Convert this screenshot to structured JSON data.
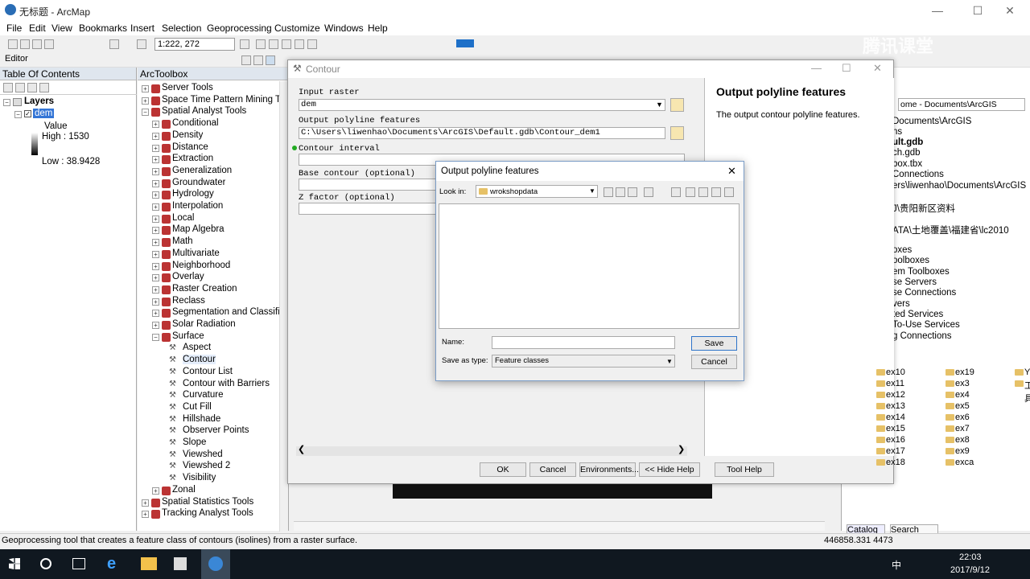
{
  "window": {
    "title": "无标题 - ArcMap"
  },
  "menu": [
    "File",
    "Edit",
    "View",
    "Bookmarks",
    "Insert",
    "Selection",
    "Geoprocessing",
    "Customize",
    "Windows",
    "Help"
  ],
  "toolbar": {
    "scale": "1:222, 272",
    "editor_label": "Editor"
  },
  "toc": {
    "title": "Table Of Contents",
    "layers_label": "Layers",
    "layer_name": "dem",
    "legend_value": "Value",
    "high": "High : 1530",
    "low": "Low : 38.9428"
  },
  "arctoolbox": {
    "title": "ArcToolbox",
    "items": [
      "Server Tools",
      "Space Time Pattern Mining To",
      "Spatial Analyst Tools",
      "Conditional",
      "Density",
      "Distance",
      "Extraction",
      "Generalization",
      "Groundwater",
      "Hydrology",
      "Interpolation",
      "Local",
      "Map Algebra",
      "Math",
      "Multivariate",
      "Neighborhood",
      "Overlay",
      "Raster Creation",
      "Reclass",
      "Segmentation and Classifica",
      "Solar Radiation",
      "Surface",
      "Aspect",
      "Contour",
      "Contour List",
      "Contour with Barriers",
      "Curvature",
      "Cut Fill",
      "Hillshade",
      "Observer Points",
      "Slope",
      "Viewshed",
      "Viewshed 2",
      "Visibility",
      "Zonal",
      "Spatial Statistics Tools",
      "Tracking Analyst Tools"
    ]
  },
  "contour": {
    "title": "Contour",
    "input_raster_label": "Input raster",
    "input_raster_value": "dem",
    "output_label": "Output polyline features",
    "output_value": "C:\\Users\\liwenhao\\Documents\\ArcGIS\\Default.gdb\\Contour_dem1",
    "interval_label": "Contour interval",
    "base_label": "Base contour (optional)",
    "zfactor_label": "Z factor (optional)",
    "buttons": {
      "ok": "OK",
      "cancel": "Cancel",
      "env": "Environments...",
      "hide_help": "<< Hide Help",
      "tool_help": "Tool Help"
    },
    "help_title": "Output polyline features",
    "help_text": "The output contour polyline features."
  },
  "save_dialog": {
    "title": "Output polyline features",
    "look_in_label": "Look in:",
    "look_in_value": "wrokshopdata",
    "col1": [
      "ex10",
      "ex11",
      "ex12",
      "ex13",
      "ex14",
      "ex15",
      "ex16",
      "ex17",
      "ex18"
    ],
    "col2": [
      "ex19",
      "ex3",
      "ex4",
      "ex5",
      "ex6",
      "ex7",
      "ex8",
      "ex9",
      "exca"
    ],
    "col3": [
      "Yanqifile",
      "工具"
    ],
    "name_label": "Name:",
    "name_value": "",
    "type_label": "Save as type:",
    "type_value": "Feature classes",
    "save": "Save",
    "cancel": "Cancel"
  },
  "catalog": {
    "location": "ome - Documents\\ArcGIS",
    "items": [
      "Documents\\ArcGIS",
      "ns",
      "ult.gdb",
      "ch.gdb",
      "box.tbx",
      "Connections",
      "ers\\liwenhao\\Documents\\ArcGIS",
      "J\\贵阳新区资料",
      "ATA\\土地覆盖\\福建省\\lc2010",
      "oxes",
      "oolboxes",
      "em Toolboxes",
      "se Servers",
      "se Connections",
      "vers",
      "ted Services",
      "To-Use Services",
      "g Connections"
    ],
    "tab_catalog": "Catalog",
    "tab_search": "Search"
  },
  "status": {
    "text": "Geoprocessing tool that creates a feature class of contours (isolines) from a raster surface.",
    "coords": "446858.331  4473"
  },
  "watermark": "腾讯课堂",
  "taskbar": {
    "time": "22:03",
    "date": "2017/9/12",
    "ime": "中"
  }
}
